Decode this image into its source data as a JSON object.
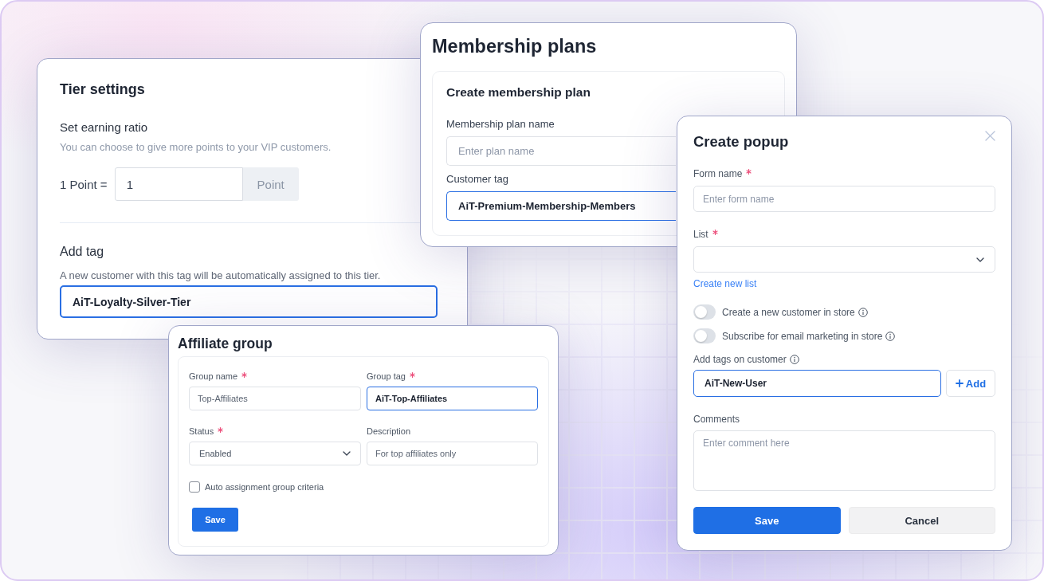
{
  "tier_settings": {
    "title": "Tier settings",
    "earning_ratio": {
      "heading": "Set earning ratio",
      "hint": "You can choose to give more points to your VIP customers.",
      "label": "1 Point =",
      "value": "1",
      "unit": "Point"
    },
    "add_tag": {
      "heading": "Add tag",
      "hint": "A new customer with this tag will be automatically assigned to this tier.",
      "value": "AiT-Loyalty-Silver-Tier",
      "focused": true
    }
  },
  "membership_plans": {
    "title": "Membership plans",
    "form": {
      "title": "Create membership plan",
      "fields": [
        {
          "label": "Membership plan name",
          "placeholder": "Enter plan name",
          "focused": false
        },
        {
          "label": "Customer tag",
          "value": "AiT-Premium-Membership-Members",
          "focused": true
        }
      ]
    }
  },
  "create_popup": {
    "title": "Create popup",
    "form_name": {
      "label": "Form name",
      "required": true,
      "placeholder": "Enter form name",
      "focused": false
    },
    "list": {
      "label": "List",
      "required": true
    },
    "create_list_link": "Create new list",
    "toggles": [
      {
        "label": "Create a new customer in store",
        "on": false
      },
      {
        "label": "Subscribe for email marketing in store",
        "on": false
      }
    ],
    "tags": {
      "label": "Add tags on customer",
      "value": "AiT-New-User",
      "focused": true,
      "add_button": "Add"
    },
    "comments": {
      "label": "Comments",
      "placeholder": "Enter comment here"
    },
    "buttons": [
      {
        "label": "Save",
        "kind": "primary"
      },
      {
        "label": "Cancel",
        "kind": "secondary"
      }
    ]
  },
  "affiliate_group": {
    "title": "Affiliate group",
    "fields": [
      {
        "kind": "text",
        "label": "Group name",
        "required": true,
        "value": "Top-Affiliates",
        "focused": false
      },
      {
        "kind": "text",
        "label": "Group tag",
        "required": true,
        "value": "AiT-Top-Affiliates",
        "focused": true
      },
      {
        "kind": "select",
        "label": "Status",
        "required": true,
        "value": "Enabled",
        "focused": false
      },
      {
        "kind": "text",
        "label": "Description",
        "required": false,
        "value": "For top affiliates only",
        "focused": false
      }
    ],
    "checkbox": {
      "label": "Auto assignment group criteria",
      "checked": false
    },
    "save_button": "Save"
  }
}
